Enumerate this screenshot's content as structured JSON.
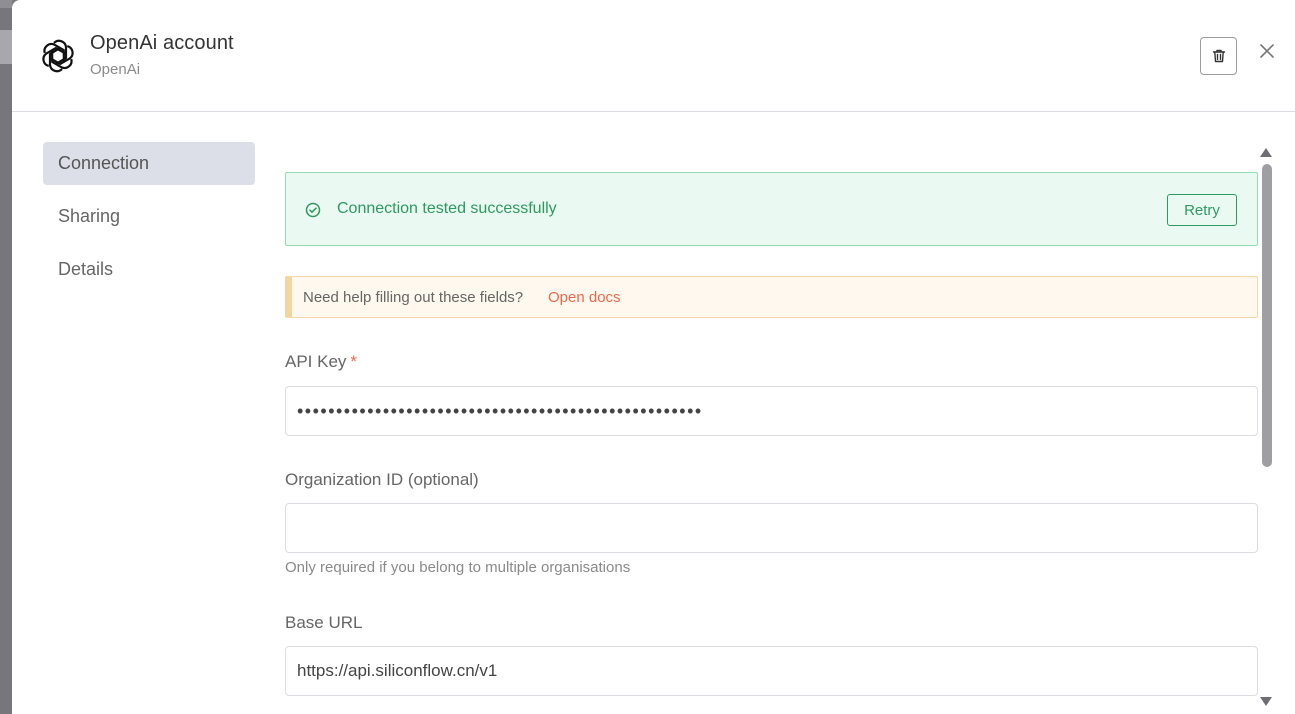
{
  "modal": {
    "title": "OpenAi account",
    "subtitle": "OpenAi",
    "logo_icon": "openai-logo-icon",
    "delete_icon": "trash-icon",
    "close_icon": "close-icon"
  },
  "nav": {
    "items": [
      {
        "label": "Connection",
        "active": true
      },
      {
        "label": "Sharing",
        "active": false
      },
      {
        "label": "Details",
        "active": false
      }
    ]
  },
  "status": {
    "message": "Connection tested successfully",
    "retry_label": "Retry",
    "icon": "check-circle-icon",
    "color": "#2e9a62"
  },
  "help": {
    "text": "Need help filling out these fields?",
    "link_label": "Open docs"
  },
  "fields": {
    "api_key": {
      "label": "API Key",
      "required_mark": "*",
      "value": "••••••••••••••••••••••••••••••••••••••••••••••••••••"
    },
    "organization_id": {
      "label": "Organization ID (optional)",
      "value": "",
      "hint": "Only required if you belong to multiple organisations"
    },
    "base_url": {
      "label": "Base URL",
      "value": "https://api.siliconflow.cn/v1"
    }
  },
  "colors": {
    "accent_link": "#ea6a4e",
    "success": "#2e9a62",
    "nav_active_bg": "#dcdfe8"
  }
}
